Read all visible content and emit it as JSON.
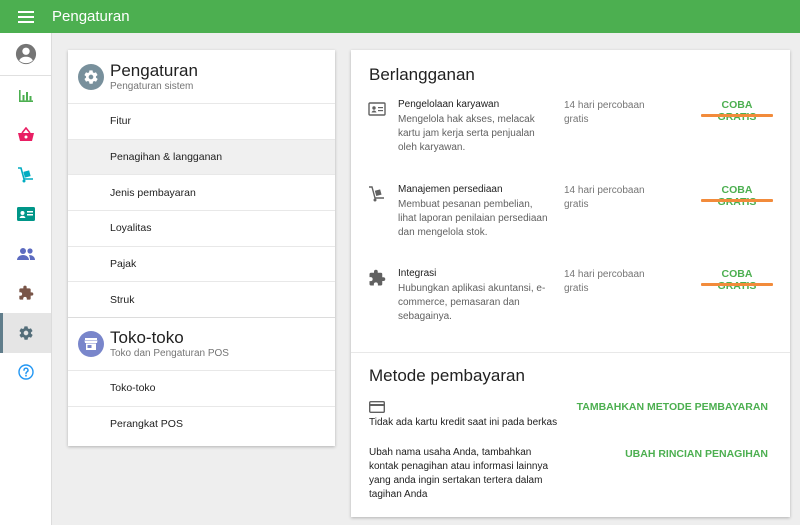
{
  "app": {
    "title": "Pengaturan",
    "brand_color": "#4caf50"
  },
  "rail": [
    {
      "icon": "account-circle-icon"
    },
    {
      "icon": "bar-chart-icon"
    },
    {
      "icon": "basket-icon"
    },
    {
      "icon": "dolly-icon"
    },
    {
      "icon": "id-card-icon"
    },
    {
      "icon": "people-icon"
    },
    {
      "icon": "puzzle-icon"
    },
    {
      "icon": "gear-icon",
      "active": true
    },
    {
      "icon": "help-circle-icon"
    }
  ],
  "settings": {
    "title": "Pengaturan",
    "subtitle": "Pengaturan sistem",
    "items": [
      "Fitur",
      "Penagihan & langganan",
      "Jenis pembayaran",
      "Loyalitas",
      "Pajak",
      "Struk"
    ],
    "selected_index": 1
  },
  "stores": {
    "title": "Toko-toko",
    "subtitle": "Toko dan Pengaturan POS",
    "items": [
      "Toko-toko",
      "Perangkat POS"
    ]
  },
  "subscription": {
    "title": "Berlangganan",
    "features": [
      {
        "icon": "id-card-icon",
        "title": "Pengelolaan karyawan",
        "desc": "Mengelola hak akses, melacak kartu jam kerja serta penjualan oleh karyawan.",
        "trial": "14 hari percobaan gratis",
        "button": "COBA GRATIS"
      },
      {
        "icon": "dolly-icon",
        "title": "Manajemen persediaan",
        "desc": "Membuat pesanan pembelian, lihat laporan penilaian persediaan dan mengelola stok.",
        "trial": "14 hari percobaan gratis",
        "button": "COBA GRATIS"
      },
      {
        "icon": "puzzle-icon",
        "title": "Integrasi",
        "desc": "Hubungkan aplikasi akuntansi, e-commerce, pemasaran dan sebagainya.",
        "trial": "14 hari percobaan gratis",
        "button": "COBA GRATIS"
      }
    ]
  },
  "payment": {
    "title": "Metode pembayaran",
    "no_card_text": "Tidak ada kartu kredit saat ini pada berkas",
    "add_method_button": "TAMBAHKAN METODE PEMBAYARAN",
    "billing_text": "Ubah nama usaha Anda, tambahkan kontak penagihan atau informasi lainnya yang anda ingin sertakan tertera dalam tagihan Anda",
    "change_billing_button": "UBAH RINCIAN PENAGIHAN"
  }
}
